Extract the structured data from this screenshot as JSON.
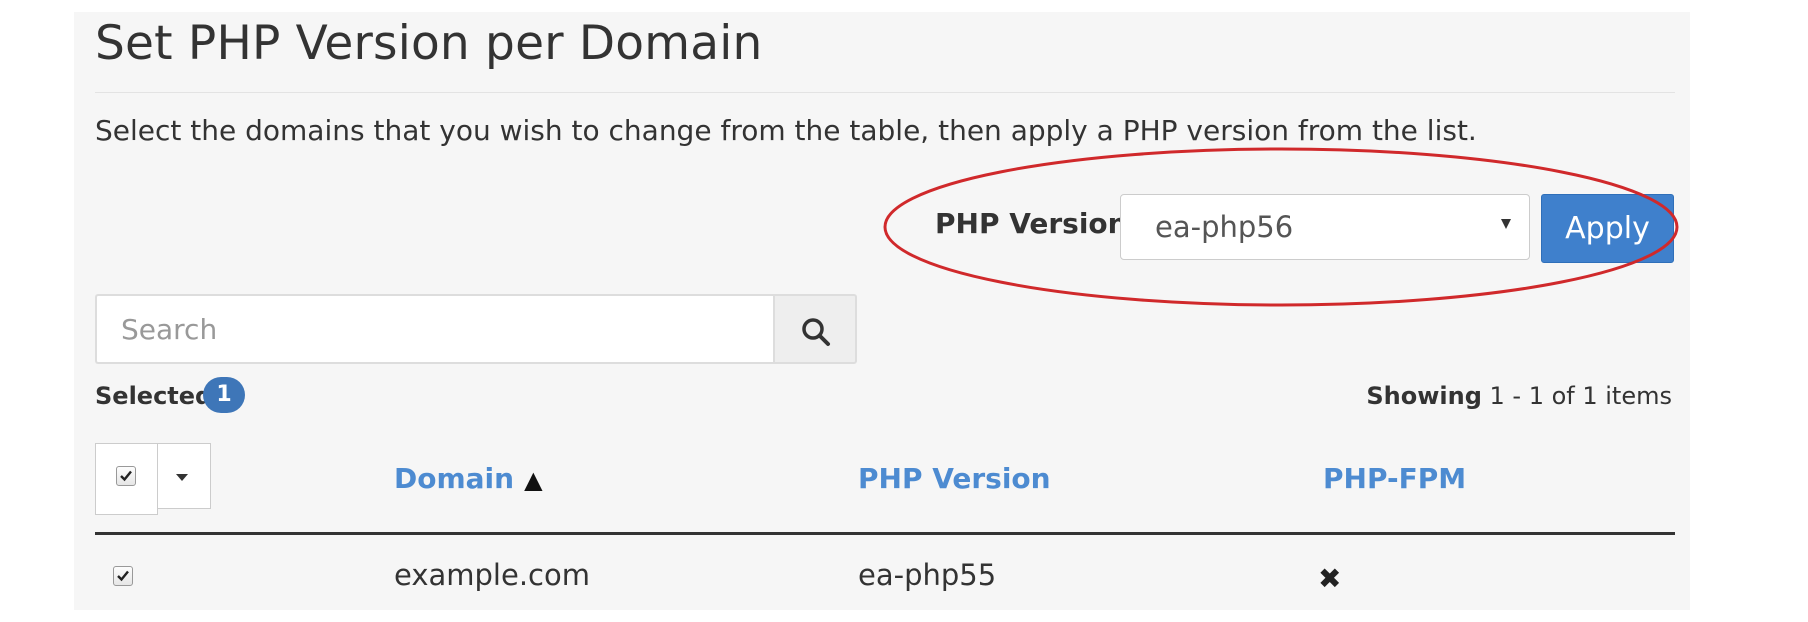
{
  "page": {
    "title": "Set PHP Version per Domain",
    "description": "Select the domains that you wish to change from the table, then apply a PHP version from the list."
  },
  "php_selector": {
    "label": "PHP Version",
    "selected_value": "ea-php56",
    "apply_label": "Apply",
    "highlight_color": "#d0292b"
  },
  "search": {
    "placeholder": "Search",
    "icon": "search-icon"
  },
  "selection": {
    "label": "Selected",
    "count": "1",
    "badge_color": "#3e76b8"
  },
  "pagination": {
    "prefix": "Showing",
    "range": "1 - 1 of 1 items"
  },
  "table": {
    "columns": [
      {
        "label": "Domain",
        "sort_indicator": "▲"
      },
      {
        "label": "PHP Version"
      },
      {
        "label": "PHP-FPM"
      }
    ],
    "rows": [
      {
        "checked": true,
        "domain": "example.com",
        "php_version": "ea-php55",
        "php_fpm": "✖"
      }
    ],
    "header_color": "#4d8bd1"
  },
  "colors": {
    "primary_button": "#3f80cc",
    "panel_background": "#f6f6f6"
  }
}
